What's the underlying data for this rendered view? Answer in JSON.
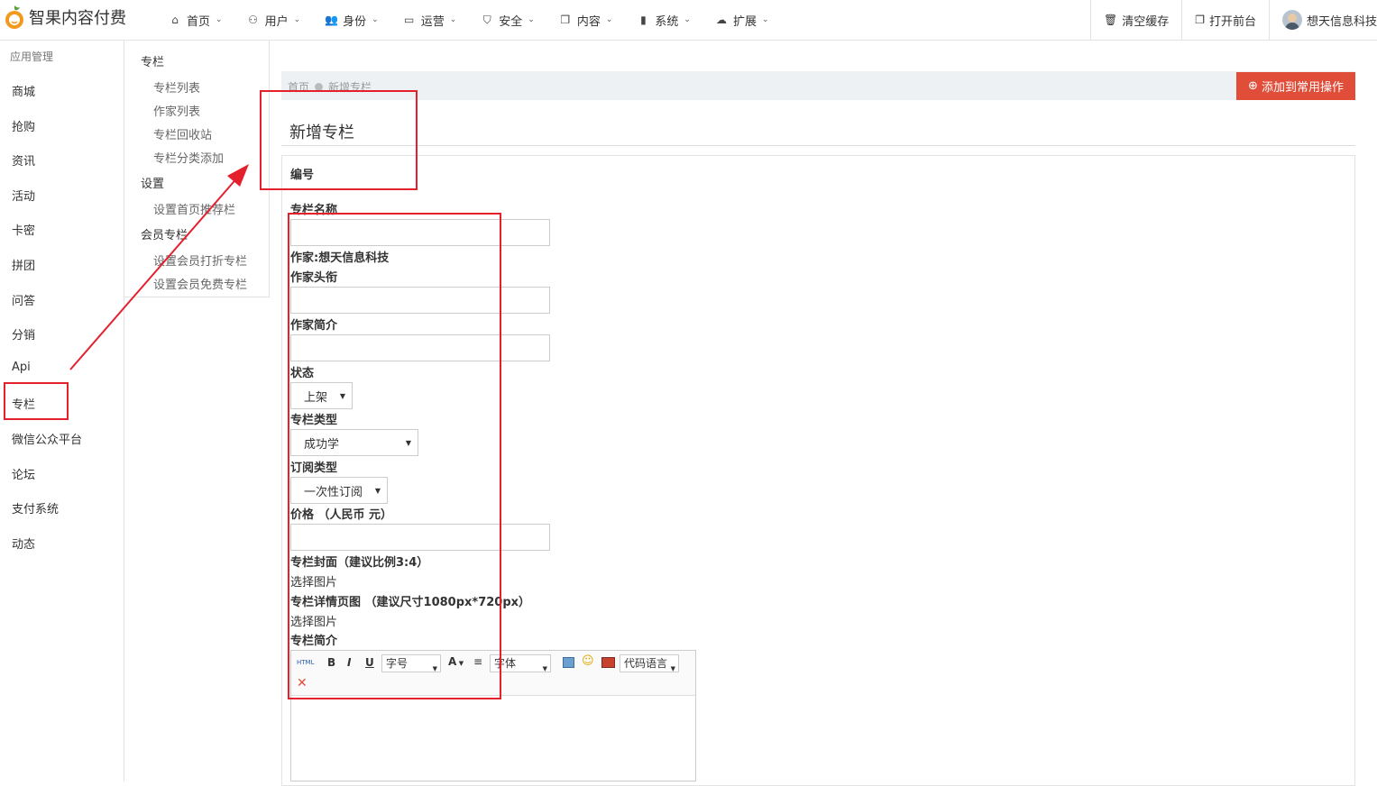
{
  "app": {
    "name": "智果内容付费"
  },
  "nav": [
    {
      "label": "首页",
      "icon": "home-icon"
    },
    {
      "label": "用户",
      "icon": "user-icon"
    },
    {
      "label": "身份",
      "icon": "users-icon"
    },
    {
      "label": "运营",
      "icon": "monitor-icon"
    },
    {
      "label": "安全",
      "icon": "shield-icon"
    },
    {
      "label": "内容",
      "icon": "copy-icon"
    },
    {
      "label": "系统",
      "icon": "book-icon"
    },
    {
      "label": "扩展",
      "icon": "cloud-icon"
    }
  ],
  "top_right": {
    "clear_cache": "清空缓存",
    "open_front": "打开前台",
    "user_name": "想天信息科技"
  },
  "sidebar": {
    "group": "应用管理",
    "items": [
      "商城",
      "抢购",
      "资讯",
      "活动",
      "卡密",
      "拼团",
      "问答",
      "分销",
      "Api",
      "专栏",
      "微信公众平台",
      "论坛",
      "支付系统",
      "动态"
    ]
  },
  "subnav": {
    "sections": [
      {
        "title": "专栏",
        "items": [
          "专栏列表",
          "作家列表",
          "专栏回收站",
          "专栏分类添加"
        ]
      },
      {
        "title": "设置",
        "items": [
          "设置首页推荐栏"
        ]
      },
      {
        "title": "会员专栏",
        "items": [
          "设置会员打折专栏",
          "设置会员免费专栏"
        ]
      }
    ]
  },
  "breadcrumb": {
    "home": "首页",
    "current": "新增专栏"
  },
  "add_common_button": "添加到常用操作",
  "page_title": "新增专栏",
  "form": {
    "id_label": "编号",
    "name_label": "专栏名称",
    "name_value": "",
    "author": "作家:想天信息科技",
    "author_title_label": "作家头衔",
    "author_title_value": "",
    "author_intro_label": "作家简介",
    "author_intro_value": "",
    "status_label": "状态",
    "status_value": "上架",
    "type_label": "专栏类型",
    "type_value": "成功学",
    "subscribe_label": "订阅类型",
    "subscribe_value": "一次性订阅",
    "price_label": "价格 （人民币 元）",
    "price_value": "",
    "cover_label": "专栏封面（建议比例3:4）",
    "cover_pick": "选择图片",
    "detail_label": "专栏详情页图 （建议尺寸1080px*720px）",
    "detail_pick": "选择图片",
    "intro_label": "专栏简介"
  },
  "editor": {
    "html_btn": "HTML",
    "bold": "B",
    "italic": "I",
    "underline": "U",
    "font_size": "字号",
    "font_color": "A",
    "font_family": "字体",
    "code_lang": "代码语言"
  },
  "colors": {
    "accent_red": "#e04e3a",
    "annotation_red": "#e5202d"
  }
}
